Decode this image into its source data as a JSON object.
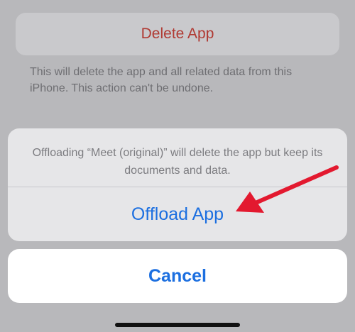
{
  "background": {
    "delete_button_label": "Delete App",
    "delete_note": "This will delete the app and all related data from this iPhone. This action can't be undone."
  },
  "action_sheet": {
    "message": "Offloading “Meet (original)” will delete the app but keep its documents and data.",
    "offload_label": "Offload App",
    "cancel_label": "Cancel"
  },
  "annotation": {
    "arrow_color": "#e3192f",
    "target": "Offload App"
  },
  "colors": {
    "accent_blue": "#1c6fe0",
    "destructive_red": "#b03a33"
  }
}
